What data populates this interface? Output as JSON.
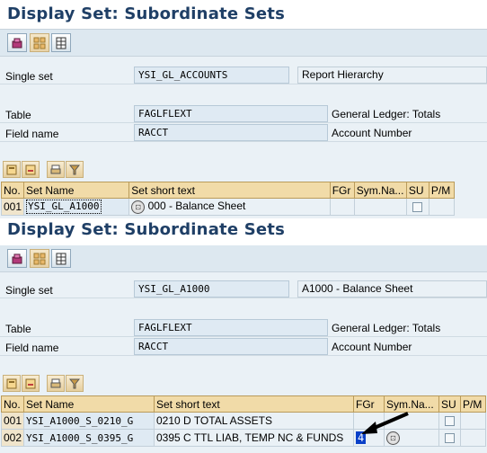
{
  "screen1": {
    "title": "Display Set: Subordinate Sets",
    "toolbar_icons": [
      "display-hierarchy-icon",
      "sets-icon",
      "document-icon"
    ],
    "single_set_label": "Single set",
    "single_set_value": "YSI_GL_ACCOUNTS",
    "single_set_desc": "Report Hierarchy",
    "table_label": "Table",
    "table_value": "FAGLFLEXT",
    "table_desc": "General Ledger: Totals",
    "field_label": "Field name",
    "field_value": "RACCT",
    "field_desc": "Account Number",
    "columns": [
      "No.",
      "Set Name",
      "Set short text",
      "FGr",
      "Sym.Na...",
      "SU",
      "P/M"
    ],
    "rows": [
      {
        "no": "001",
        "set_name": "YSI_GL_A1000",
        "short_text": "000 - Balance Sheet",
        "fgr": "",
        "sym": "",
        "su": false,
        "pm": ""
      }
    ]
  },
  "screen2": {
    "title": "Display Set: Subordinate Sets",
    "toolbar_icons": [
      "display-hierarchy-icon",
      "sets-icon",
      "document-icon"
    ],
    "single_set_label": "Single set",
    "single_set_value": "YSI_GL_A1000",
    "single_set_desc": "A1000 - Balance Sheet",
    "table_label": "Table",
    "table_value": "FAGLFLEXT",
    "table_desc": "General Ledger: Totals",
    "field_label": "Field name",
    "field_value": "RACCT",
    "field_desc": "Account Number",
    "columns": [
      "No.",
      "Set Name",
      "Set short text",
      "FGr",
      "Sym.Na...",
      "SU",
      "P/M"
    ],
    "rows": [
      {
        "no": "001",
        "set_name": "YSI_A1000_S_0210_G",
        "short_text": "0210 D  TOTAL ASSETS",
        "fgr": "",
        "sym": "",
        "su": false,
        "pm": ""
      },
      {
        "no": "002",
        "set_name": "YSI_A1000_S_0395_G",
        "short_text": "0395  C  TTL LIAB, TEMP NC & FUNDS",
        "fgr": "4",
        "sym": "",
        "su": false,
        "pm": ""
      }
    ]
  },
  "colors": {
    "title": "#1f3f66",
    "header_bg": "#f1dba8",
    "panel_bg": "#eaf1f6",
    "field_bg": "#dfeaf3",
    "selection": "#0a40c8"
  }
}
